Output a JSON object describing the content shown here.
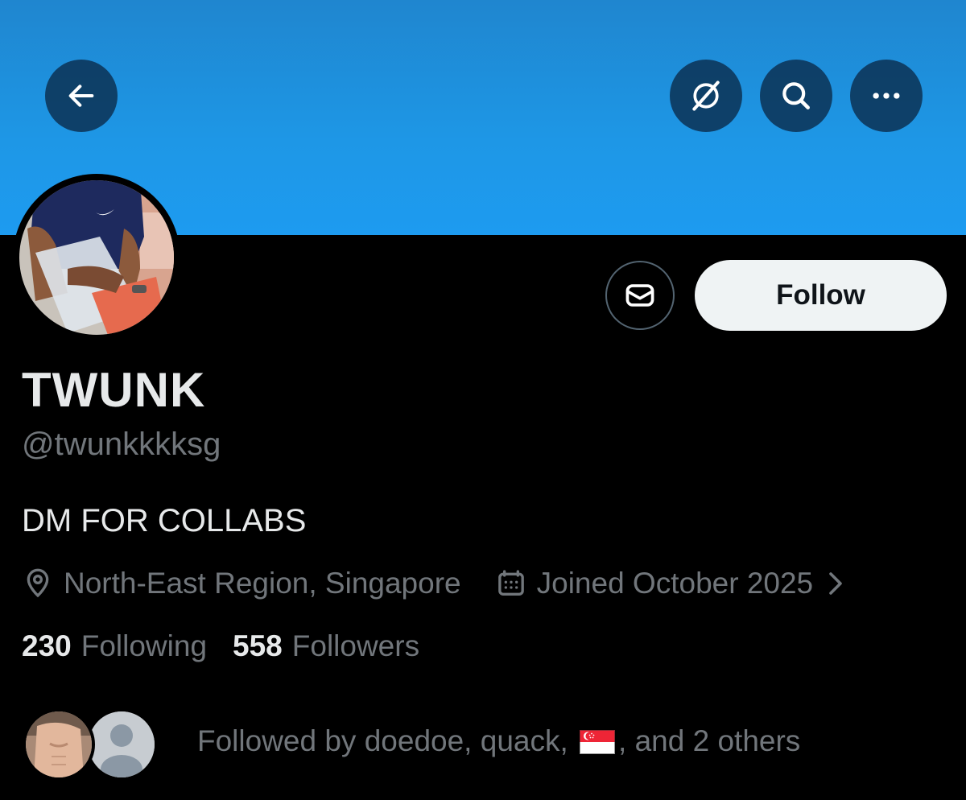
{
  "header": {
    "back_icon": "arrow-left-icon",
    "grok_icon": "grok-icon",
    "search_icon": "search-icon",
    "more_icon": "more-horizontal-icon",
    "banner_color": "#1d9bf0"
  },
  "profile": {
    "display_name": "TWUNK",
    "handle": "@twunkkkksg",
    "bio": "DM FOR COLLABS",
    "location": "North-East Region, Singapore",
    "joined": "Joined October 2025",
    "following_count": "230",
    "following_label": "Following",
    "followers_count": "558",
    "followers_label": "Followers"
  },
  "actions": {
    "message_icon": "envelope-icon",
    "follow_label": "Follow"
  },
  "followed_by": {
    "prefix": "Followed by doedoe, quack, ",
    "flag_icon": "singapore-flag-icon",
    "suffix": ", and 2 others"
  },
  "colors": {
    "background": "#000000",
    "primary_text": "#e7e9ea",
    "secondary_text": "#71767b",
    "follow_button_bg": "#eff3f4"
  }
}
